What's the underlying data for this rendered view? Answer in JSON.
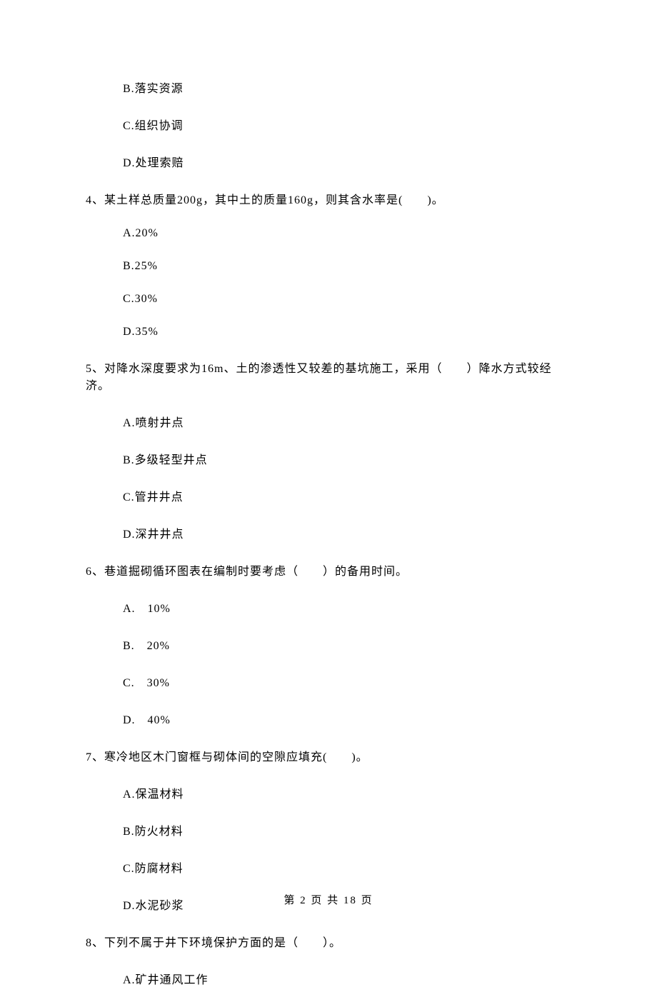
{
  "options_top": [
    "B.落实资源",
    "C.组织协调",
    "D.处理索赔"
  ],
  "q4": {
    "text": "4、某土样总质量200g，其中土的质量160g，则其含水率是(　　)。",
    "options": [
      "A.20%",
      "B.25%",
      "C.30%",
      "D.35%"
    ]
  },
  "q5": {
    "text": "5、对降水深度要求为16m、土的渗透性又较差的基坑施工，采用（　　）降水方式较经济。",
    "options": [
      "A.喷射井点",
      "B.多级轻型井点",
      "C.管井井点",
      "D.深井井点"
    ]
  },
  "q6": {
    "text": "6、巷道掘砌循环图表在编制时要考虑（　　）的备用时间。",
    "options": [
      "A.　10%",
      "B.　20%",
      "C.　30%",
      "D.　40%"
    ]
  },
  "q7": {
    "text": "7、寒冷地区木门窗框与砌体间的空隙应填充(　　)。",
    "options": [
      "A.保温材料",
      "B.防火材料",
      "C.防腐材料",
      "D.水泥砂浆"
    ]
  },
  "q8": {
    "text": "8、下列不属于井下环境保护方面的是（　　）。",
    "options": [
      "A.矿井通风工作"
    ]
  },
  "footer": "第 2 页 共 18 页"
}
